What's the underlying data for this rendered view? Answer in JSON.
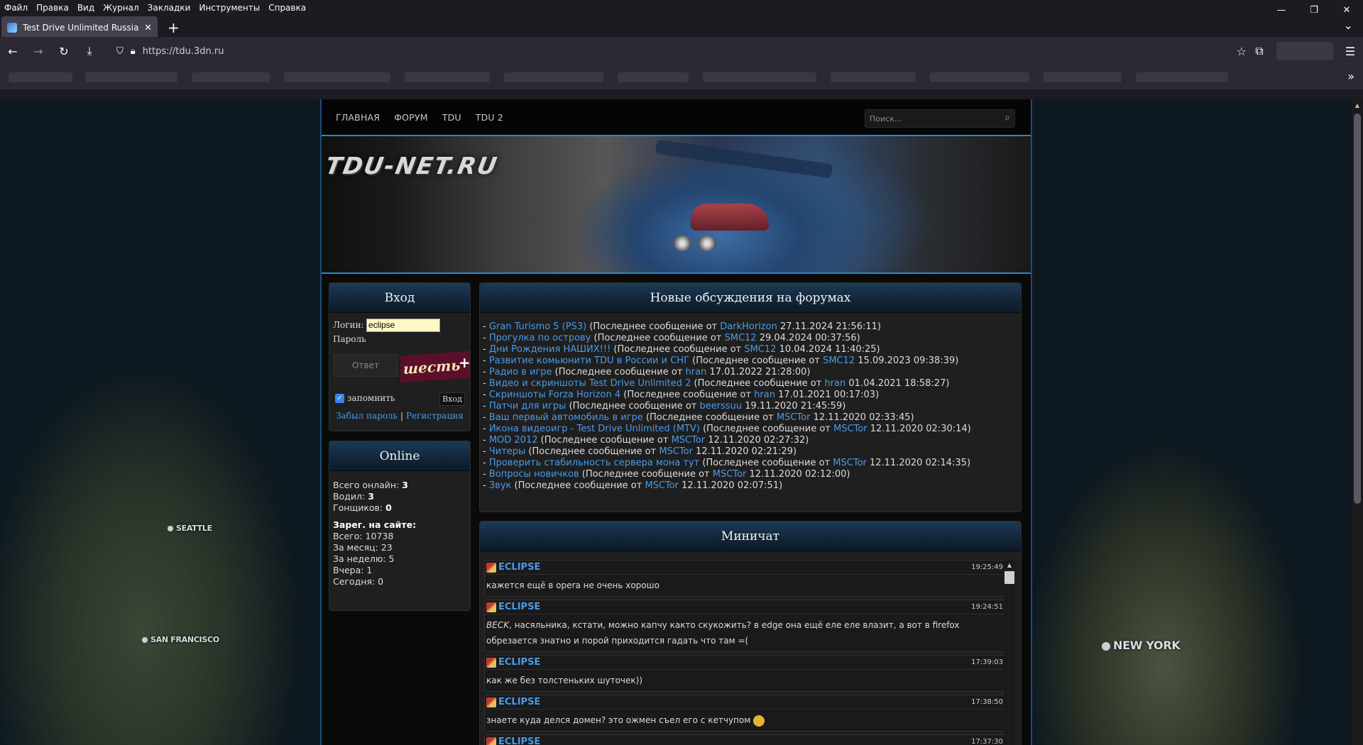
{
  "menubar": [
    "Файл",
    "Правка",
    "Вид",
    "Журнал",
    "Закладки",
    "Инструменты",
    "Справка"
  ],
  "window_controls": {
    "minimize": "—",
    "restore": "❐",
    "close": "✕"
  },
  "tab": {
    "title": "Test Drive Unlimited Russia - Or",
    "close": "✕"
  },
  "newtab_symbol": "+",
  "tablist_symbol": "⌄",
  "nav": {
    "back": "←",
    "forward": "→",
    "reload": "↻",
    "download": "⤓",
    "url": "https://tdu.3dn.ru",
    "star": "☆",
    "extensions": "⧉",
    "menu": "☰"
  },
  "bookmarks_more": "»",
  "site": {
    "nav": [
      "ГЛАВНАЯ",
      "ФОРУМ",
      "TDU",
      "TDU 2"
    ],
    "search_placeholder": "Поиск...",
    "logo": "TDU-NET.RU"
  },
  "login": {
    "title": "Вход",
    "login_label": "Логин:",
    "login_value": "eclipse",
    "password_label": "Пароль:",
    "answer_placeholder": "Ответ",
    "captcha_text": "шесть",
    "captcha_plus": "+",
    "remember_label": "запомнить",
    "button_label": "Вход",
    "forgot_link": "Забыл пароль",
    "separator": "|",
    "register_link": "Регистрация"
  },
  "online": {
    "title": "Online",
    "total_label": "Всего онлайн:",
    "total": "3",
    "drivers_label": "Водил:",
    "drivers": "3",
    "racers_label": "Гонщиков:",
    "racers": "0",
    "registered_title": "Зарег. на сайте:",
    "all": "Всего: 10738",
    "month": "За месяц: 23",
    "week": "За неделю: 5",
    "yesterday": "Вчера: 1",
    "today": "Сегодня: 0"
  },
  "forum": {
    "title": "Новые обсуждения на форумах",
    "prefix": "- ",
    "last_msg_label": " (Последнее сообщение от ",
    "items": [
      {
        "topic": "Gran Turismo 5 (PS3)",
        "author": "DarkHorizon",
        "date": " 27.11.2024 21:56:11)"
      },
      {
        "topic": "Прогулка по острову",
        "author": "SMC12",
        "date": " 29.04.2024 00:37:56)"
      },
      {
        "topic": "Дни Рождения НАШИХ!!!",
        "author": "SMC12",
        "date": " 10.04.2024 11:40:25)"
      },
      {
        "topic": "Развитие комьюнити TDU в России и СНГ",
        "author": "SMC12",
        "date": " 15.09.2023 09:38:39)"
      },
      {
        "topic": "Радио в игре",
        "author": "hran",
        "date": " 17.01.2022 21:28:00)"
      },
      {
        "topic": "Видео и скриншоты Test Drive Unlimited 2",
        "author": "hran",
        "date": " 01.04.2021 18:58:27)"
      },
      {
        "topic": "Скриншоты Forza Horizon 4",
        "author": "hran",
        "date": " 17.01.2021 00:17:03)"
      },
      {
        "topic": "Патчи для игры",
        "author": "beerssuu",
        "date": " 19.11.2020 21:45:59)"
      },
      {
        "topic": "Ваш первый автомобиль в игре",
        "author": "MSCTor",
        "date": " 12.11.2020 02:33:45)"
      },
      {
        "topic": "Икона видеоигр - Test Drive Unlimited (MTV)",
        "author": "MSCTor",
        "date": " 12.11.2020 02:30:14)"
      },
      {
        "topic": "MOD 2012",
        "author": "MSCTor",
        "date": " 12.11.2020 02:27:32)"
      },
      {
        "topic": "Читеры",
        "author": "MSCTor",
        "date": " 12.11.2020 02:21:29)"
      },
      {
        "topic": "Проверить стабильность сервера мона тут",
        "author": "MSCTor",
        "date": " 12.11.2020 02:14:35)"
      },
      {
        "topic": "Вопросы новичков",
        "author": "MSCTor",
        "date": " 12.11.2020 02:12:00)"
      },
      {
        "topic": "Звук",
        "author": "MSCTor",
        "date": " 12.11.2020 02:07:51)"
      }
    ]
  },
  "chat": {
    "title": "Миничат",
    "messages": [
      {
        "user": "ECLIPSE",
        "time": "19:25:49",
        "text": "кажется ещё в opera не очень хорошо"
      },
      {
        "user": "ECLIPSE",
        "time": "19:24:51",
        "mention": "BECK",
        "text": ", насяльника, кстати, можно капчу както скукожить? в edge она ещё еле еле влазит, а вот в firefox обрезается знатно и порой приходится гадать что там =("
      },
      {
        "user": "ECLIPSE",
        "time": "17:39:03",
        "text": "как же без толстеньких шуточек))"
      },
      {
        "user": "ECLIPSE",
        "time": "17:38:50",
        "text": "знаете куда делся домен? это ожмен съел его с кетчупом"
      },
      {
        "user": "ECLIPSE",
        "time": "17:37:30",
        "text": ""
      }
    ]
  },
  "map_labels": {
    "seattle": "SEATTLE",
    "sf": "SAN FRANCISCO",
    "ny": "NEW YORK"
  }
}
